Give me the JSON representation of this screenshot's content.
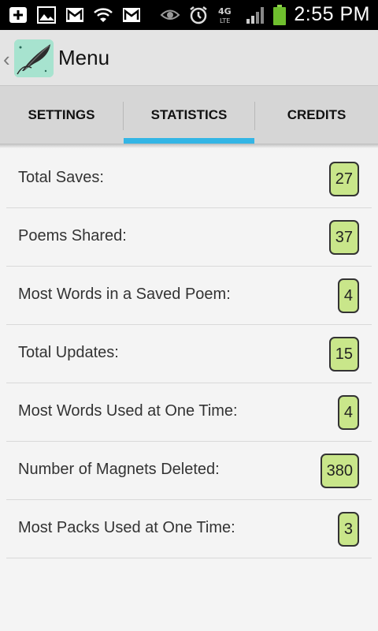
{
  "status_bar": {
    "time": "2:55 PM",
    "icons": [
      "add-icon",
      "gallery-icon",
      "gmail-icon",
      "wifi-icon",
      "gmail-icon",
      "eye-icon",
      "alarm-icon",
      "4g-lte-icon",
      "signal-icon",
      "battery-icon"
    ]
  },
  "action_bar": {
    "title": "Menu",
    "icon": "app-logo-quill-icon"
  },
  "tabs": [
    {
      "label": "SETTINGS",
      "selected": false
    },
    {
      "label": "STATISTICS",
      "selected": true
    },
    {
      "label": "CREDITS",
      "selected": false
    }
  ],
  "stats": [
    {
      "label": "Total Saves:",
      "value": "27"
    },
    {
      "label": "Poems Shared:",
      "value": "37"
    },
    {
      "label": "Most Words in a Saved Poem:",
      "value": "4"
    },
    {
      "label": "Total Updates:",
      "value": "15"
    },
    {
      "label": "Most Words Used at One Time:",
      "value": "4"
    },
    {
      "label": "Number of Magnets Deleted:",
      "value": "380"
    },
    {
      "label": "Most Packs Used at One Time:",
      "value": "3"
    }
  ],
  "colors": {
    "accent": "#33b5e5",
    "badge_fill": "#c9e68a",
    "battery": "#6fbf2e"
  }
}
